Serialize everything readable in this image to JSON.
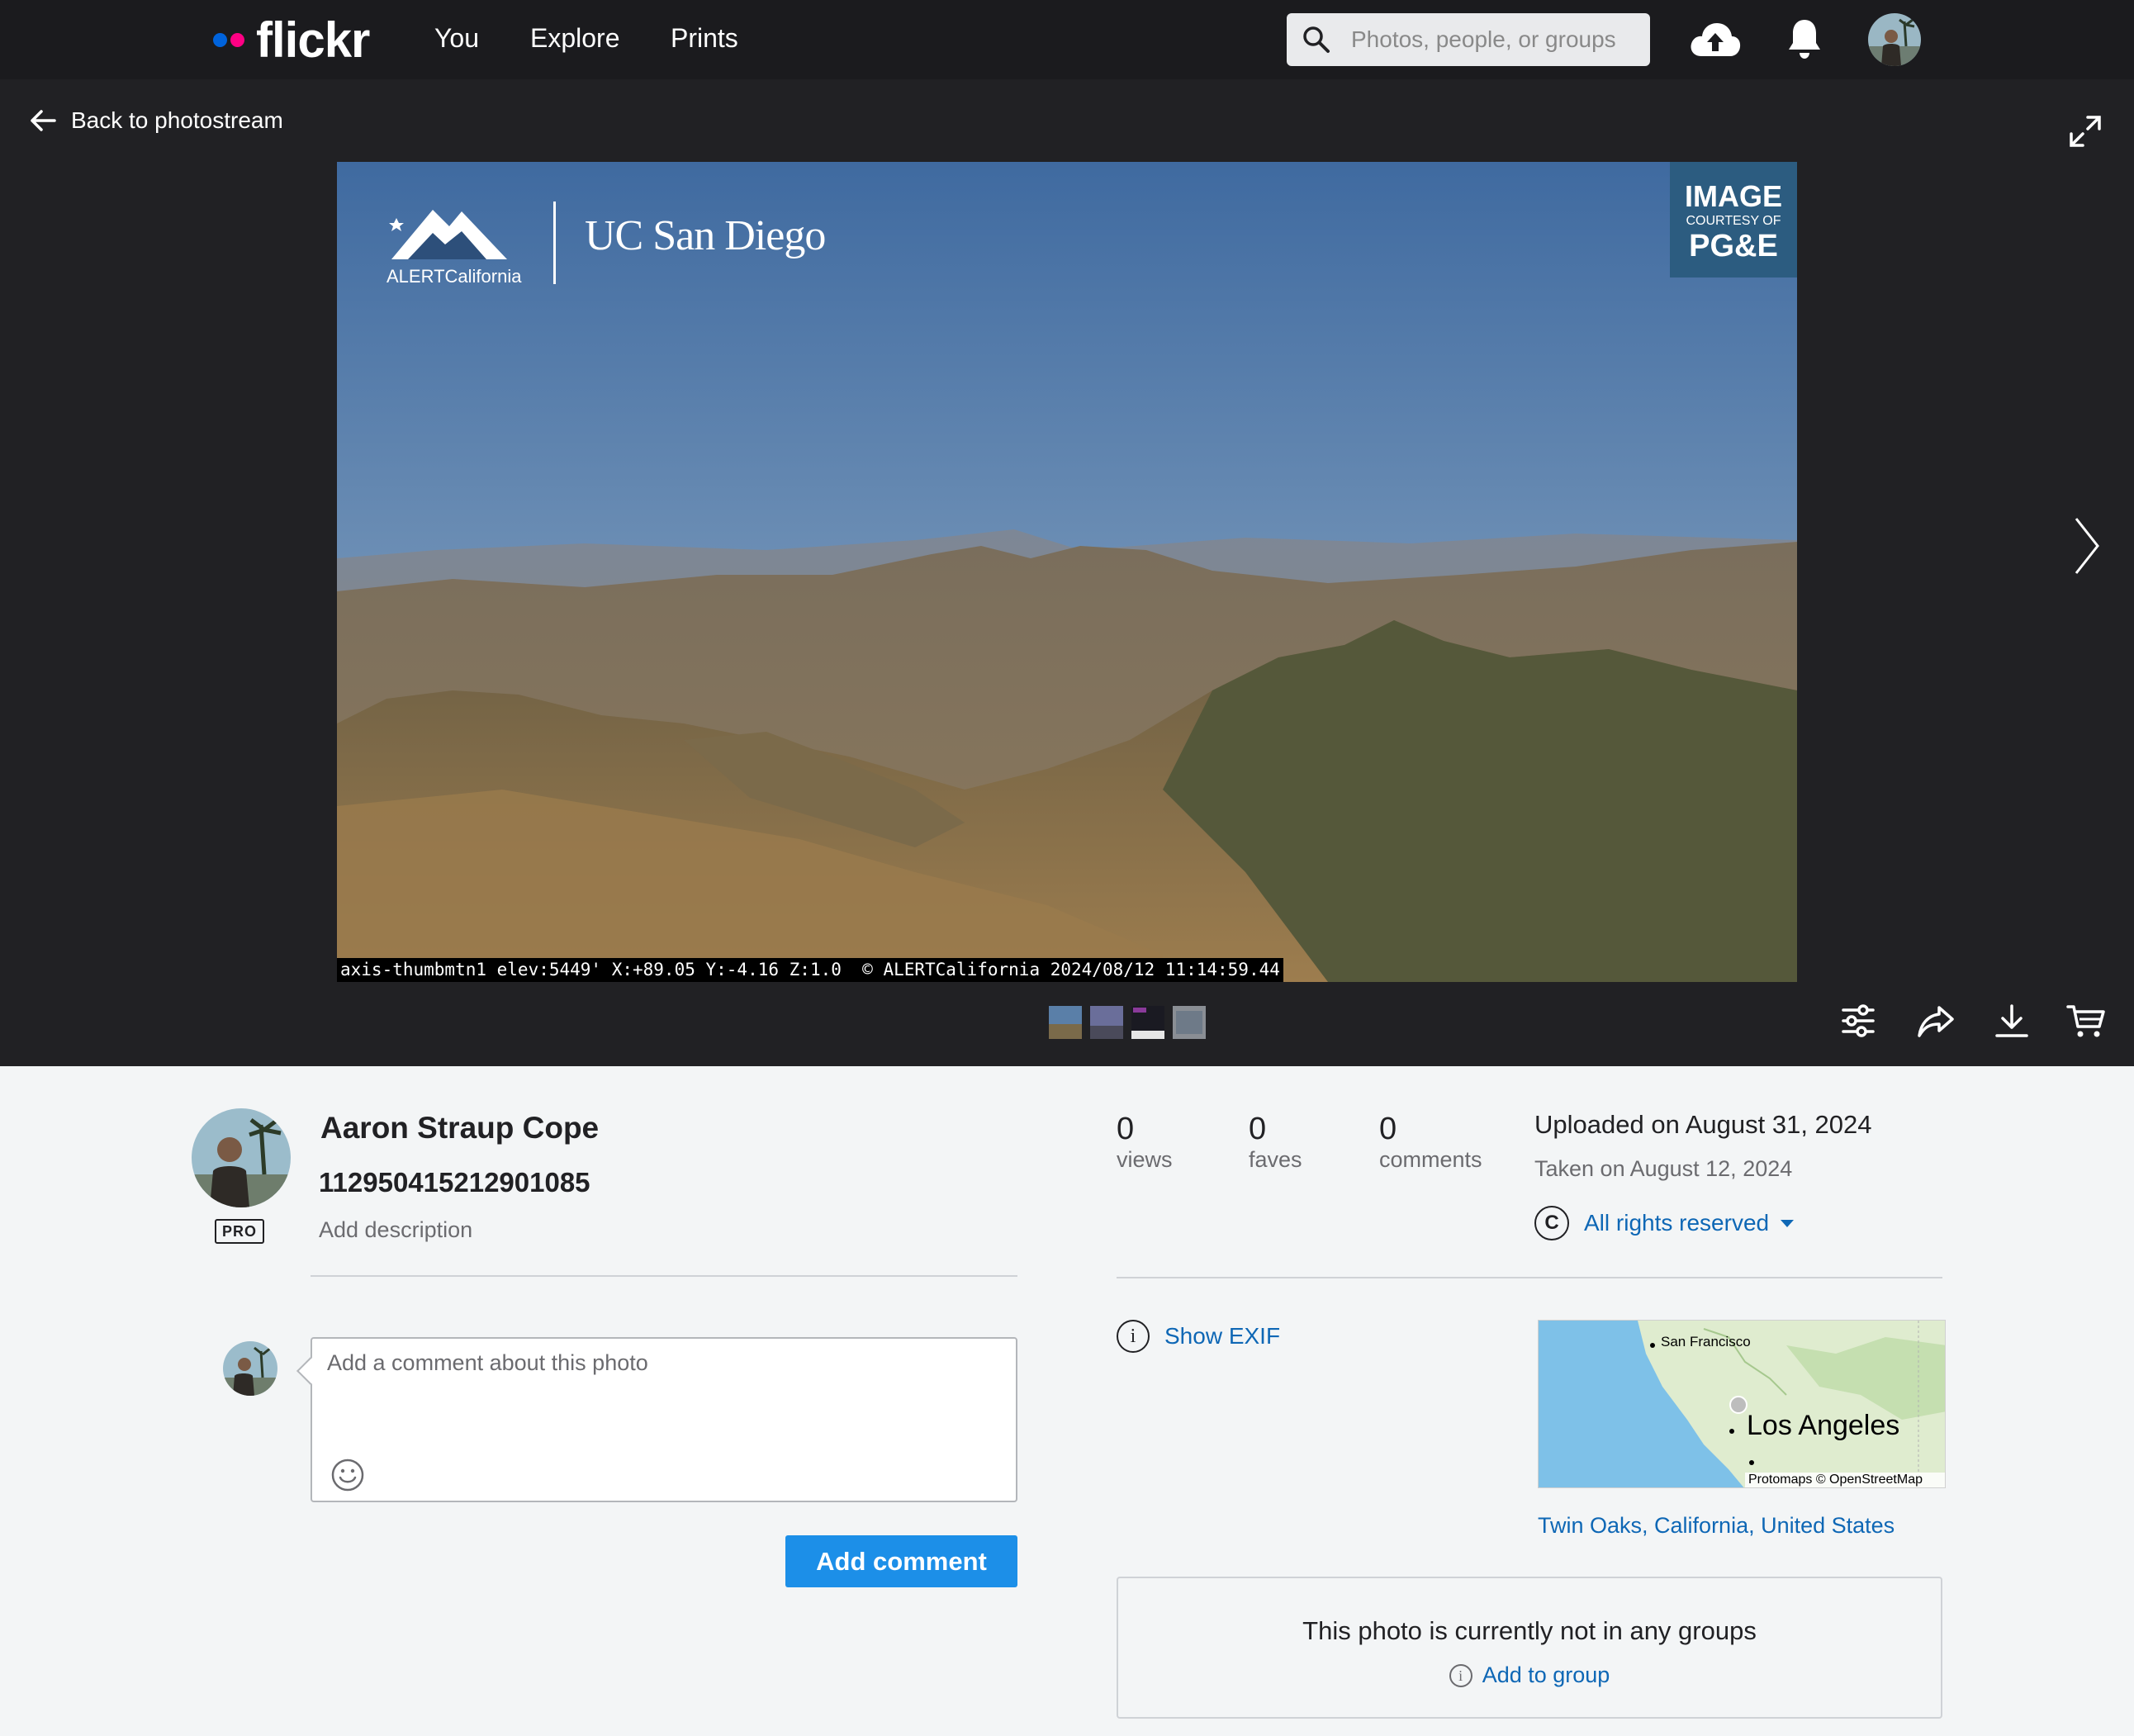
{
  "nav": {
    "logo": "flickr",
    "links": [
      "You",
      "Explore",
      "Prints"
    ],
    "search_placeholder": "Photos, people, or groups"
  },
  "stage": {
    "back_label": "Back to photostream",
    "photo_overlay": {
      "ucsd": "UC San Diego",
      "alert": "ALERTCalifornia",
      "pge_line1": "IMAGE",
      "pge_line2": "COURTESY OF",
      "pge_line3": "PG&E",
      "camera_caption": "axis-thumbmtn1 elev:5449' X:+89.05 Y:-4.16 Z:1.0  © ALERTCalifornia 2024/08/12 11:14:59.44"
    },
    "thumbnails_count": 4,
    "tools": [
      "adjust-icon",
      "share-icon",
      "download-icon",
      "cart-icon"
    ]
  },
  "owner": {
    "name": "Aaron Straup Cope",
    "badge": "PRO",
    "photo_title": "112950415212901085",
    "add_description": "Add description"
  },
  "comment": {
    "placeholder": "Add a comment about this photo",
    "button": "Add comment"
  },
  "stats": {
    "views": {
      "num": "0",
      "label": "views"
    },
    "faves": {
      "num": "0",
      "label": "faves"
    },
    "comments": {
      "num": "0",
      "label": "comments"
    }
  },
  "info": {
    "uploaded": "Uploaded on August 31, 2024",
    "taken": "Taken on August 12, 2024",
    "license_icon": "C",
    "license": "All rights reserved",
    "exif": "Show EXIF"
  },
  "map": {
    "city1": "San Francisco",
    "city2": "Los Angeles",
    "attribution": "Protomaps © OpenStreetMap",
    "location": "Twin Oaks, California, United States"
  },
  "groups": {
    "message": "This photo is currently not in any groups",
    "add": "Add to group"
  },
  "colors": {
    "nav_bg": "#1b1b1e",
    "stage_bg": "#212124",
    "link": "#0e67b5",
    "button": "#1c8fe8",
    "flickr_blue": "#0063dc",
    "flickr_pink": "#ff0084"
  }
}
